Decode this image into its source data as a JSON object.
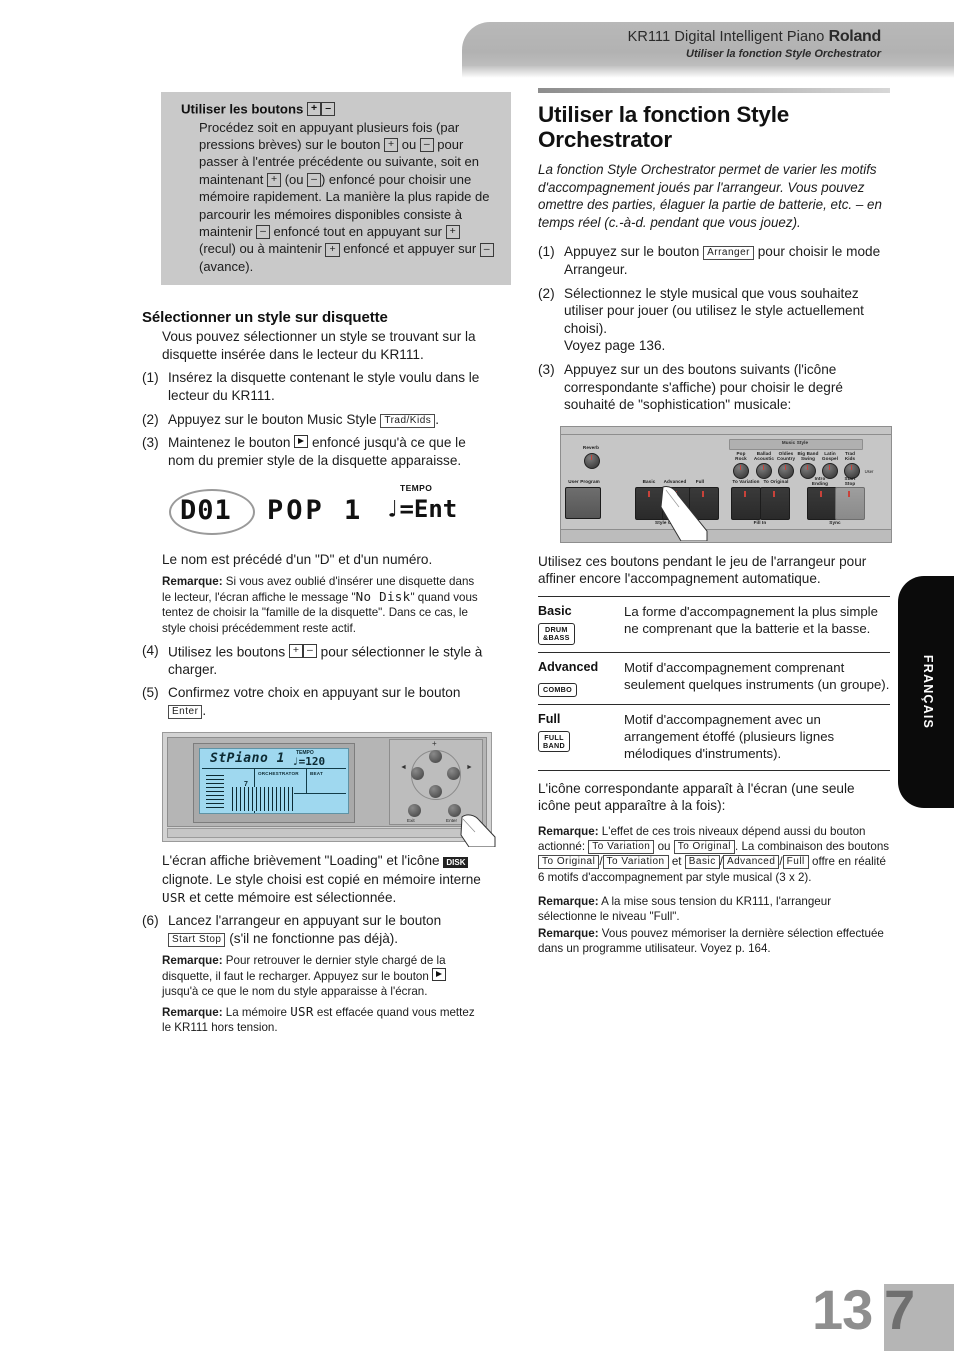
{
  "header": {
    "title_main": "KR111 Digital Intelligent Piano ",
    "brand": "Roland",
    "subtitle": "Utiliser la fonction Style Orchestrator"
  },
  "left": {
    "callout": {
      "heading": "Utiliser les boutons ",
      "body": "Procédez soit en appuyant plusieurs fois (par pressions brèves) sur le bouton ",
      "body2": " ou ",
      "body3": " pour passer à l'entrée précédente ou suivante, soit en maintenant ",
      "body4": " (ou ",
      "body5": ") enfoncé pour choisir une mémoire rapidement. La manière la plus rapide de parcourir les mémoires disponibles consiste à maintenir ",
      "body6": " enfoncé tout en appuyant sur ",
      "body7": " (recul) ou à maintenir ",
      "body8": " enfoncé et appuyer sur ",
      "body9": " (avance)."
    },
    "section_heading": "Sélectionner un style sur disquette",
    "section_intro": "Vous pouvez sélectionner un style se trouvant sur la disquette insérée dans le lecteur du KR111.",
    "steps": [
      {
        "n": "(1)",
        "text": "Insérez la disquette contenant le style voulu dans le lecteur du KR111."
      },
      {
        "n": "(2)",
        "text_a": "Appuyez sur le bouton Music Style ",
        "key": "Trad/Kids",
        "text_b": "."
      },
      {
        "n": "(3)",
        "text_a": "Maintenez le bouton ",
        "text_b": " enfoncé jusqu'à ce que le nom du premier style de la disquette apparaisse."
      },
      {
        "n": "(4)",
        "text_a": "Utilisez les boutons ",
        "text_b": " pour sélectionner le style à charger."
      },
      {
        "n": "(5)",
        "text_a": "Confirmez votre choix en appuyant sur le bouton ",
        "key": "Enter",
        "text_b": "."
      },
      {
        "n": "(6)",
        "text_a": "Lancez l'arrangeur en appuyant sur le bouton ",
        "key": "Start Stop",
        "text_b": " (s'il ne fonctionne pas déjà)."
      }
    ],
    "lcd_figure": {
      "number": "D01",
      "style_name": "POP 1",
      "tempo_label": "TEMPO",
      "tempo_value": "♩=Ent"
    },
    "caption_after_lcd": "Le nom est précédé d'un \"D\" et d'un numéro.",
    "remark1": {
      "label": "Remarque:",
      "text_a": " Si vous avez oublié d'insérer une disquette dans le lecteur, l'écran affiche le message \"",
      "lcd": "No Disk",
      "text_b": "\" quand vous tentez de choisir la \"famille de la disquette\". Dans ce cas, le style choisi précédemment reste actif."
    },
    "panel_figure": {
      "screen_title": "StPiano 1",
      "screen_tempo_label": "TEMPO",
      "screen_tempo": "♩=120",
      "screen_orchestrator": "ORCHESTRATOR",
      "screen_beat": "BEAT",
      "screen_number": "7",
      "pad_plus": "+",
      "pad_minus": "–",
      "exit_label": "Exit",
      "enter_label": "Enter"
    },
    "after_panel": {
      "text_a": "L'écran affiche brièvement \"Loading\" et l'icône ",
      "icon": "DISK",
      "text_b": " clignote. Le style choisi est copié en mémoire interne ",
      "usr": "USR",
      "text_c": " et cette mémoire est sélectionnée."
    },
    "remark2": {
      "label": "Remarque:",
      "text_a": " Pour retrouver le dernier style chargé de la disquette, il faut le recharger. Appuyez sur le bouton ",
      "text_b": " jusqu'à ce que le nom du style apparaisse à l'écran."
    },
    "remark3": {
      "label": "Remarque:",
      "text_a": " La mémoire ",
      "usr": "USR",
      "text_b": " est effacée quand vous mettez le KR111 hors tension."
    }
  },
  "right": {
    "title": "Utiliser la fonction Style Orchestrator",
    "intro": "La fonction Style Orchestrator permet de varier les motifs d'accompagnement joués par l'arrangeur. Vous pouvez omettre des parties, élaguer la partie de batterie, etc. – en temps réel (c.-à-d. pendant que vous jouez).",
    "steps": [
      {
        "n": "(1)",
        "text_a": "Appuyez sur le bouton ",
        "key": "Arranger",
        "text_b": " pour choisir le mode Arrangeur."
      },
      {
        "n": "(2)",
        "text_a": "Sélectionnez le style musical que vous souhaitez utiliser pour jouer (ou utilisez le style actuellement choisi).",
        "sub": "Voyez page 136."
      },
      {
        "n": "(3)",
        "text_a": "Appuyez sur un des boutons suivants (l'icône correspondante s'affiche) pour choisir le degré souhaité de \"sophistication\" musicale:"
      }
    ],
    "panel": {
      "reverb": "Reverb",
      "user_program": "User Program",
      "music_style_title": "Music Style",
      "music_style_knobs": [
        "Pop\nRock",
        "Ballad\nAcoustic",
        "Oldies\nCountry",
        "Big Band\nSwing",
        "Latin\nGospel",
        "Trad\nKids"
      ],
      "user_label": "User",
      "orchestrator_buttons": [
        "Basic",
        "Advanced",
        "Full"
      ],
      "orchestrator_caption": "Style Orchestrator",
      "fillin_buttons": [
        "To Variation",
        "To Original"
      ],
      "fillin_caption": "Fill In",
      "transport_buttons": [
        "Intro\nEnding",
        "Start\nStop"
      ],
      "transport_caption": "Sync"
    },
    "panel_caption": "Utilisez ces boutons pendant le jeu de l'arrangeur pour affiner encore l'accompagnement automatique.",
    "table": [
      {
        "name": "Basic",
        "icon": "DRUM\n&BASS",
        "desc": "La forme d'accompagnement la plus simple ne comprenant que la batterie et la basse."
      },
      {
        "name": "Advanced",
        "icon": "COMBO",
        "desc": "Motif d'accompagnement comprenant seulement quelques instruments (un groupe)."
      },
      {
        "name": "Full",
        "icon": "FULL\nBAND",
        "desc": "Motif d'accompagnement avec un arrangement étoffé (plusieurs lignes mélodiques d'instruments)."
      }
    ],
    "after_table": "L'icône correspondante apparaît à l'écran (une seule icône peut apparaître à la fois):",
    "remark1": {
      "label": "Remarque:",
      "t1": " L'effet de ces trois niveaux dépend aussi du bouton actionné: ",
      "k1": "To Variation",
      "t2": " ou ",
      "k2": "To Original",
      "t3": ". La combinaison des boutons ",
      "k3": "To Original",
      "t4": "/",
      "k4": "To Variation",
      "t5": " et ",
      "k5": "Basic",
      "t6": "/",
      "k6": "Advanced",
      "t7": "/",
      "k7": "Full",
      "t8": " offre en réalité 6 motifs d'accompagnement par style musical (3 x 2)."
    },
    "remark2": {
      "label": "Remarque:",
      "text": " A la mise sous tension du KR111, l'arrangeur sélectionne le niveau \"Full\"."
    },
    "remark3": {
      "label": "Remarque:",
      "text": " Vous pouvez mémoriser la dernière sélection effectuée dans un programme utilisateur. Voyez p. 164."
    }
  },
  "side_tab": "FRANÇAIS",
  "page_number_left": "13",
  "page_number_right": "7",
  "keys": {
    "plus": "+",
    "minus": "–"
  }
}
